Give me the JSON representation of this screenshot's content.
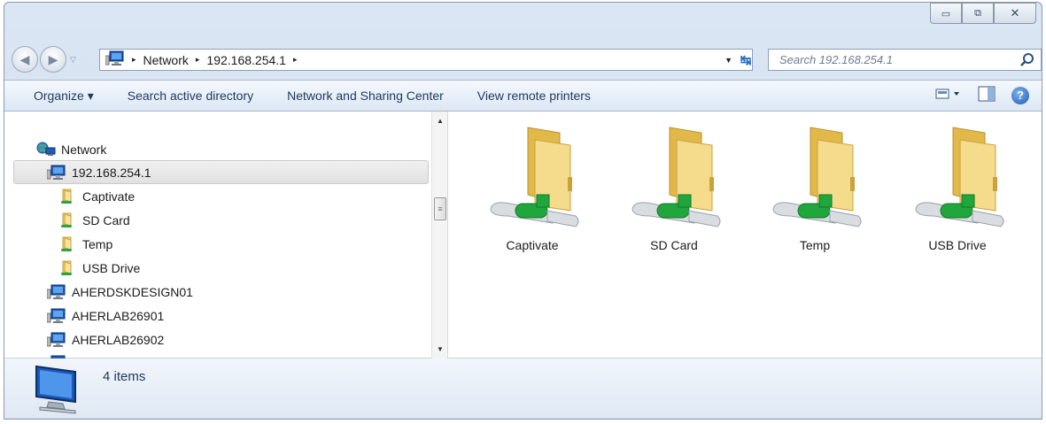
{
  "window": {
    "caption_buttons": [
      "minimize-icon",
      "restore-icon",
      "close-icon"
    ]
  },
  "address": {
    "segments": [
      "Network",
      "192.168.254.1"
    ],
    "separator": "▸"
  },
  "search": {
    "placeholder": "Search 192.168.254.1"
  },
  "toolbar": {
    "organize": "Organize ▾",
    "search_ad": "Search active directory",
    "network_center": "Network and Sharing Center",
    "view_printers": "View remote printers",
    "views_icon": "change-view-icon",
    "preview_icon": "preview-pane-icon",
    "help_icon": "help-icon",
    "help_glyph": "?"
  },
  "tree": {
    "root": "Network",
    "selected": "192.168.254.1",
    "shares": [
      "Captivate",
      "SD Card",
      "Temp",
      "USB Drive"
    ],
    "computers": [
      "AHERDSKDESIGN01",
      "AHERLAB26901",
      "AHERLAB26902"
    ]
  },
  "files": [
    "Captivate",
    "SD Card",
    "Temp",
    "USB Drive"
  ],
  "status": {
    "count": "4 items"
  },
  "colors": {
    "chrome": "#dbe6f4",
    "toolbar_text": "#1e395b",
    "folder": "#f2d27a",
    "share_pipe": "#21a83e"
  }
}
